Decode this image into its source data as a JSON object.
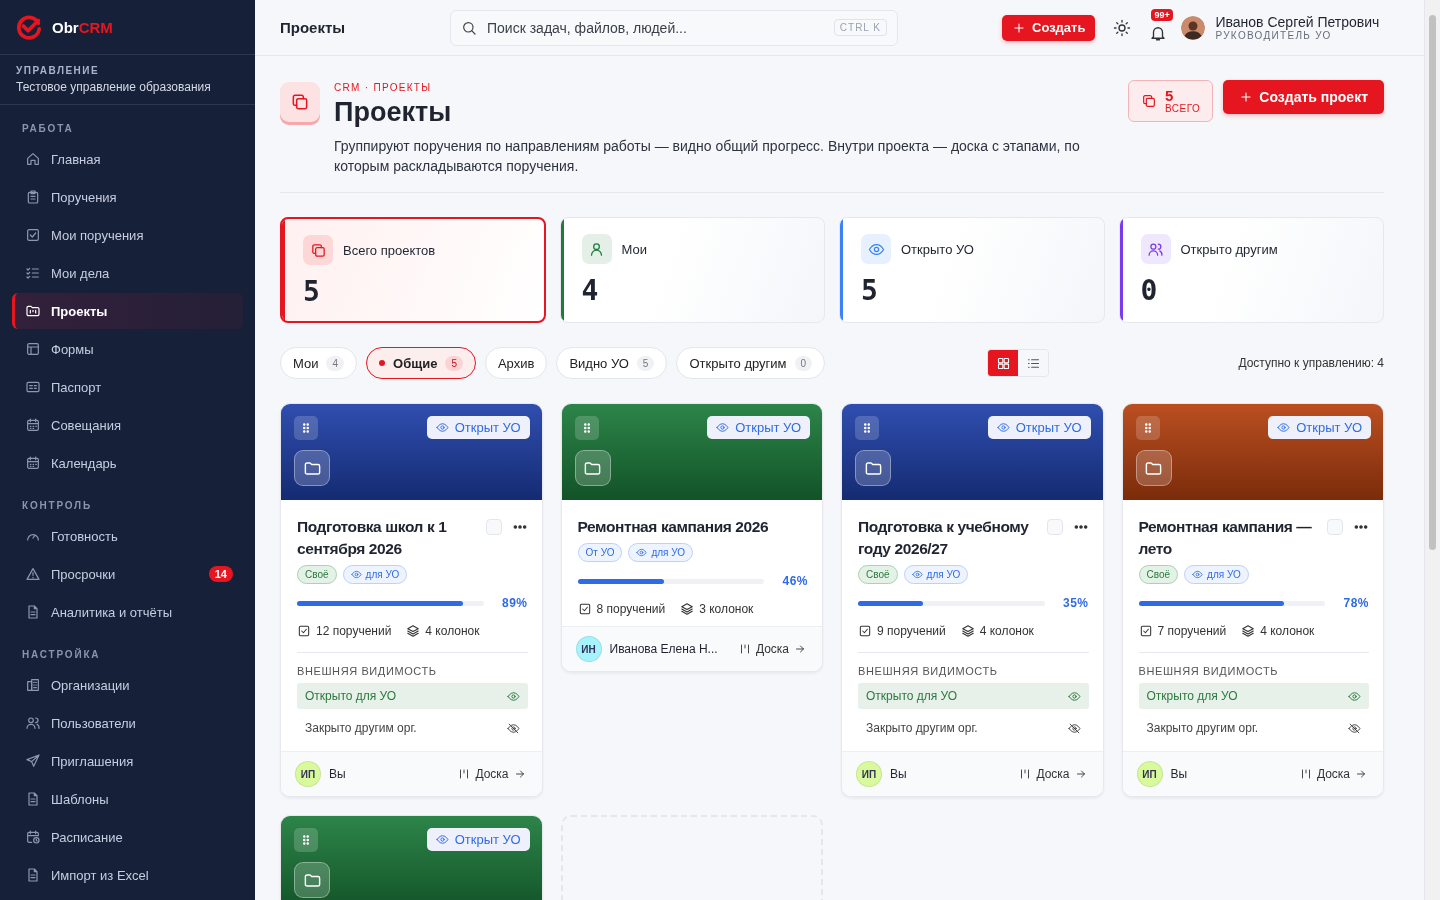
{
  "sidebar": {
    "logo": {
      "prefix": "Obr",
      "accent": "CRM"
    },
    "org": {
      "label": "УПРАВЛЕНИЕ",
      "name": "Тестовое управление образования"
    },
    "sections": [
      {
        "title": "РАБОТА",
        "items": [
          {
            "label": "Главная",
            "selected": false
          },
          {
            "label": "Поручения",
            "selected": false
          },
          {
            "label": "Мои поручения",
            "selected": false
          },
          {
            "label": "Мои дела",
            "selected": false
          },
          {
            "label": "Проекты",
            "selected": true
          },
          {
            "label": "Формы",
            "selected": false
          },
          {
            "label": "Паспорт",
            "selected": false
          },
          {
            "label": "Совещания",
            "selected": false
          },
          {
            "label": "Календарь",
            "selected": false
          }
        ]
      },
      {
        "title": "КОНТРОЛЬ",
        "items": [
          {
            "label": "Готовность",
            "selected": false
          },
          {
            "label": "Просрочки",
            "selected": false,
            "badge": "14"
          },
          {
            "label": "Аналитика и отчёты",
            "selected": false
          }
        ]
      },
      {
        "title": "НАСТРОЙКА",
        "items": [
          {
            "label": "Организации",
            "selected": false
          },
          {
            "label": "Пользователи",
            "selected": false
          },
          {
            "label": "Приглашения",
            "selected": false
          },
          {
            "label": "Шаблоны",
            "selected": false
          },
          {
            "label": "Расписание",
            "selected": false
          },
          {
            "label": "Импорт из Excel",
            "selected": false
          }
        ]
      }
    ]
  },
  "topbar": {
    "title": "Проекты",
    "search": {
      "placeholder": "Поиск задач, файлов, людей...",
      "shortcut": "CTRL K"
    },
    "create_button": "Создать",
    "notifications": "99+",
    "user": {
      "name": "Иванов Сергей Петрович",
      "role": "РУКОВОДИТЕЛЬ УО"
    }
  },
  "header": {
    "breadcrumb": "CRM · ПРОЕКТЫ",
    "title": "Проекты",
    "description": "Группируют поручения по направлениям работы — видно общий прогресс. Внутри проекта — доска с этапами, по которым раскладываются поручения.",
    "total": {
      "count": "5",
      "label": "ВСЕГО"
    },
    "create_button": "Создать проект"
  },
  "stats": [
    {
      "label": "Всего проектов",
      "value": "5",
      "color": "#e5161f",
      "selected": true
    },
    {
      "label": "Мои",
      "value": "4",
      "color": "#1f7a3c",
      "selected": false
    },
    {
      "label": "Открыто УО",
      "value": "5",
      "color": "#3b82f6",
      "selected": false
    },
    {
      "label": "Открыто другим",
      "value": "0",
      "color": "#7c3aed",
      "selected": false
    }
  ],
  "filters": [
    {
      "label": "Мои",
      "count": "4",
      "selected": false
    },
    {
      "label": "Общие",
      "count": "5",
      "selected": true
    },
    {
      "label": "Архив",
      "selected": false
    },
    {
      "label": "Видно УО",
      "count": "5",
      "selected": false
    },
    {
      "label": "Открыто другим",
      "count": "0",
      "selected": false
    }
  ],
  "view_toggle": [
    {
      "kind": "grid",
      "selected": true
    },
    {
      "kind": "list",
      "selected": false
    }
  ],
  "access_note": "Доступно к управлению: 4",
  "projects": [
    {
      "kind": "project",
      "color": "#1e3fa8",
      "badge": "Открыт УО",
      "title": "Подготовка школ к 1 сентября 2026",
      "checked": false,
      "tags": [
        {
          "kind": "own",
          "label": "Своё"
        },
        {
          "kind": "visible",
          "label": "для УО"
        }
      ],
      "level": 0.89,
      "percent": "89%",
      "tasks": "12 поручений",
      "columns": "4 колонок",
      "visibility": {
        "label": "ВНЕШНЯЯ ВИДИМОСТЬ",
        "items": [
          {
            "label": "Открыто для УО",
            "open": true
          },
          {
            "label": "Закрыто другим орг.",
            "open": false
          }
        ]
      },
      "owner": {
        "initials": "ИП",
        "name": "Вы",
        "color": "#d9f99d"
      },
      "link": "Доска"
    },
    {
      "kind": "project",
      "color": "#1b7a3a",
      "badge": "Открыт УО",
      "title": "Ремонтная кампания 2026",
      "tags": [
        {
          "kind": "from",
          "label": "От УО"
        },
        {
          "kind": "visible",
          "label": "для УО"
        }
      ],
      "level": 0.46,
      "percent": "46%",
      "tasks": "8 поручений",
      "columns": "3 колонок",
      "owner": {
        "initials": "ИН",
        "name": "Иванова Елена Н...",
        "color": "#a5f3fc"
      },
      "link": "Доска"
    },
    {
      "kind": "project",
      "color": "#1e3fa8",
      "badge": "Открыт УО",
      "title": "Подготовка к учебному году 2026/27",
      "checked": false,
      "tags": [
        {
          "kind": "own",
          "label": "Своё"
        },
        {
          "kind": "visible",
          "label": "для УО"
        }
      ],
      "level": 0.35,
      "percent": "35%",
      "tasks": "9 поручений",
      "columns": "4 колонок",
      "visibility": {
        "label": "ВНЕШНЯЯ ВИДИМОСТЬ",
        "items": [
          {
            "label": "Открыто для УО",
            "open": true
          },
          {
            "label": "Закрыто другим орг.",
            "open": false
          }
        ]
      },
      "owner": {
        "initials": "ИП",
        "name": "Вы",
        "color": "#d9f99d"
      },
      "link": "Доска"
    },
    {
      "kind": "project",
      "color": "#b5400f",
      "badge": "Открыт УО",
      "title": "Ремонтная кампания — лето",
      "checked": false,
      "tags": [
        {
          "kind": "own",
          "label": "Своё"
        },
        {
          "kind": "visible",
          "label": "для УО"
        }
      ],
      "level": 0.78,
      "percent": "78%",
      "tasks": "7 поручений",
      "columns": "4 колонок",
      "visibility": {
        "label": "ВНЕШНЯЯ ВИДИМОСТЬ",
        "items": [
          {
            "label": "Открыто для УО",
            "open": true
          },
          {
            "label": "Закрыто другим орг.",
            "open": false
          }
        ]
      },
      "owner": {
        "initials": "ИП",
        "name": "Вы",
        "color": "#d9f99d"
      },
      "link": "Доска"
    },
    {
      "kind": "project",
      "color": "#1b7a3a",
      "badge": "Открыт УО"
    },
    {
      "kind": "placeholder"
    }
  ]
}
